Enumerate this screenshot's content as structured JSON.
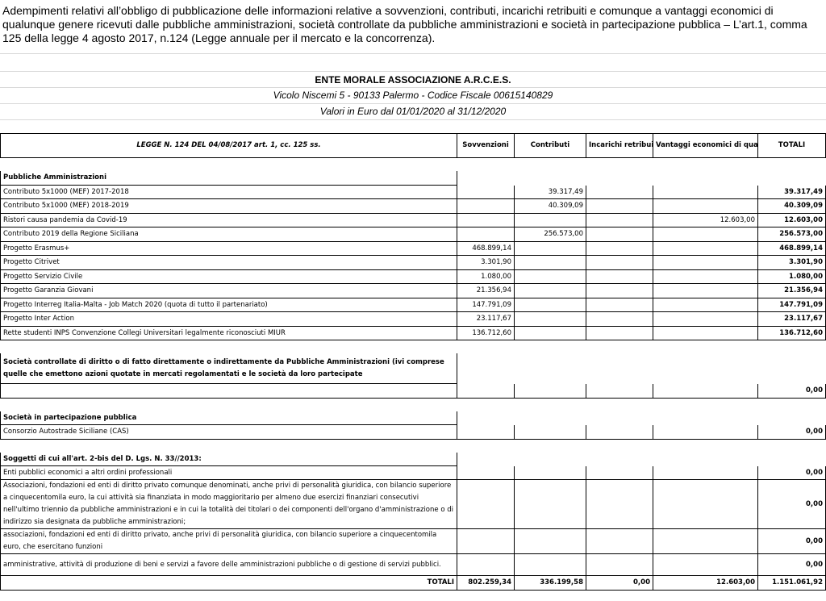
{
  "intro": "Adempimenti relativi all’obbligo di pubblicazione delle informazioni relative a sovvenzioni, contributi, incarichi retribuiti e comunque a vantaggi economici di qualunque genere ricevuti dalle pubbliche amministrazioni, società controllate da pubbliche amministrazioni e società in partecipazione pubblica – L’art.1, comma 125 della legge 4 agosto 2017, n.124 (Legge annuale per il mercato e la concorrenza).",
  "entity": {
    "name": "ENTE MORALE ASSOCIAZIONE A.R.C.E.S.",
    "address": "Vicolo Niscemi 5 - 90133 Palermo - Codice Fiscale 00615140829",
    "period": "Valori in Euro dal 01/01/2020 al 31/12/2020"
  },
  "table": {
    "headers": {
      "law": "LEGGE N. 124 DEL 04/08/2017 art. 1, cc. 125 ss.",
      "sovvenzioni": "Sovvenzioni",
      "contributi": "Contributi",
      "incarichi": "Incarichi retribuiti",
      "vantaggi": "Vantaggi economici di qualunque genere",
      "totali": "TOTALI"
    },
    "sections": {
      "pa": "Pubbliche Amministrazioni",
      "controllate": "Società controllate di diritto o di fatto direttamente o indirettamente da Pubbliche Amministrazioni (ivi comprese quelle che emettono azioni quotate in mercati regolamentati e le società da loro partecipate",
      "partecipazione": "Società in partecipazione pubblica",
      "soggetti": "Soggetti di cui all'art. 2-bis del D. Lgs. N. 33//2013:"
    },
    "pa_rows": [
      {
        "label": "Contributo 5x1000 (MEF) 2017-2018",
        "sov": "",
        "con": "39.317,49",
        "inc": "",
        "van": "",
        "tot": "39.317,49"
      },
      {
        "label": "Contributo 5x1000 (MEF) 2018-2019",
        "sov": "",
        "con": "40.309,09",
        "inc": "",
        "van": "",
        "tot": "40.309,09"
      },
      {
        "label": "Ristori causa pandemia da Covid-19",
        "sov": "",
        "con": "",
        "inc": "",
        "van": "12.603,00",
        "tot": "12.603,00"
      },
      {
        "label": "Contributo 2019 della Regione Siciliana",
        "sov": "",
        "con": "256.573,00",
        "inc": "",
        "van": "",
        "tot": "256.573,00"
      },
      {
        "label": "Progetto Erasmus+",
        "sov": "468.899,14",
        "con": "",
        "inc": "",
        "van": "",
        "tot": "468.899,14"
      },
      {
        "label": "Progetto Citrivet",
        "sov": "3.301,90",
        "con": "",
        "inc": "",
        "van": "",
        "tot": "3.301,90"
      },
      {
        "label": "Progetto Servizio Civile",
        "sov": "1.080,00",
        "con": "",
        "inc": "",
        "van": "",
        "tot": "1.080,00"
      },
      {
        "label": "Progetto Garanzia Giovani",
        "sov": "21.356,94",
        "con": "",
        "inc": "",
        "van": "",
        "tot": "21.356,94"
      },
      {
        "label": "Progetto Interreg Italia-Malta - Job Match 2020 (quota di tutto il partenariato)",
        "sov": "147.791,09",
        "con": "",
        "inc": "",
        "van": "",
        "tot": "147.791,09"
      },
      {
        "label": "Progetto Inter Action",
        "sov": "23.117,67",
        "con": "",
        "inc": "",
        "van": "",
        "tot": "23.117,67"
      },
      {
        "label": "Rette studenti INPS Convenzione Collegi Universitari legalmente riconosciuti MIUR",
        "sov": "136.712,60",
        "con": "",
        "inc": "",
        "van": "",
        "tot": "136.712,60"
      }
    ],
    "controllate_total": "0,00",
    "cas_label": "Consorzio Autostrade Siciliane (CAS)",
    "cas_total": "0,00",
    "soggetti_rows": [
      {
        "label": "Enti pubblici economici a altri ordini professionali",
        "tot": "0,00"
      },
      {
        "label": "Associazioni, fondazioni ed enti di diritto privato comunque denominati, anche privi di personalità giuridica, con bilancio superiore a cinquecentomila euro, la cui attività sia finanziata in modo maggioritario per almeno due esercizi finanziari consecutivi nell'ultimo triennio da pubbliche amministrazioni e in cui la totalità dei titolari o dei componenti dell'organo d'amministrazione o di indirizzo sia designata da pubbliche amministrazioni;",
        "tot": "0,00"
      },
      {
        "label": "associazioni, fondazioni ed enti di diritto privato, anche privi di personalità giuridica, con bilancio superiore a cinquecentomila euro, che esercitano funzioni",
        "tot": "0,00"
      },
      {
        "label": "amministrative, attività di produzione di beni e servizi a favore delle amministrazioni pubbliche o di gestione di servizi pubblici.",
        "tot": "0,00"
      }
    ],
    "totals": {
      "label": "TOTALI",
      "sov": "802.259,34",
      "con": "336.199,58",
      "inc": "0,00",
      "van": "12.603,00",
      "tot": "1.151.061,92"
    }
  }
}
